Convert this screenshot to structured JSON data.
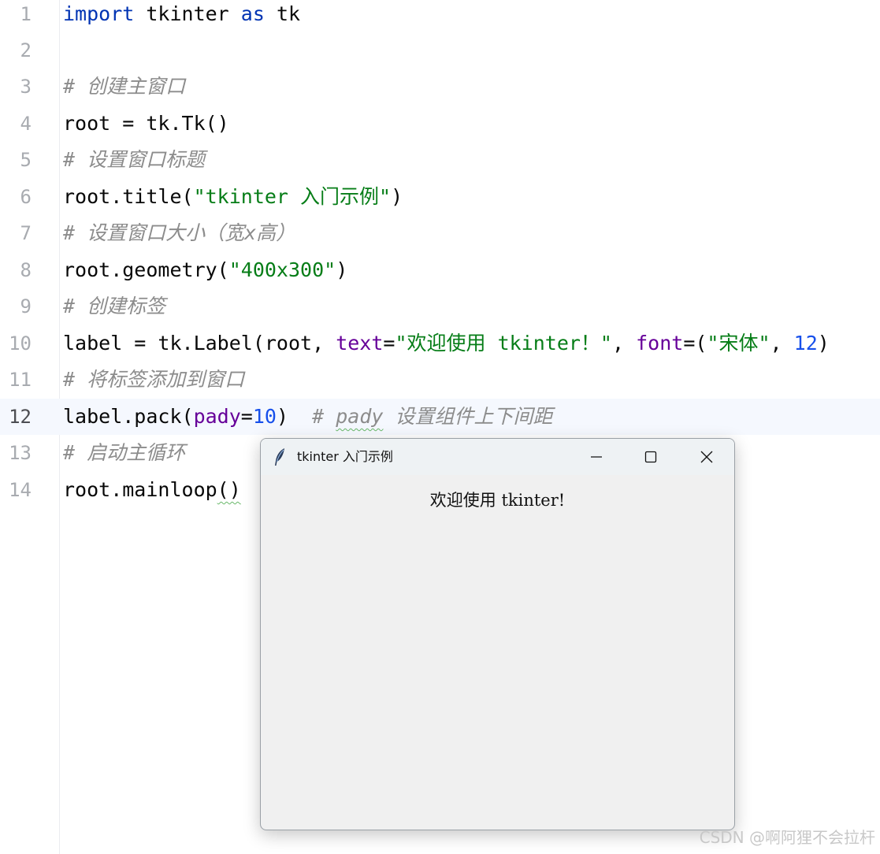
{
  "editor": {
    "current_line": 12,
    "line_numbers": [
      "1",
      "2",
      "3",
      "4",
      "5",
      "6",
      "7",
      "8",
      "9",
      "10",
      "11",
      "12",
      "13",
      "14"
    ],
    "code": {
      "l1": {
        "kw_import": "import",
        "mod1": " tkinter ",
        "kw_as": "as",
        "alias": " tk"
      },
      "l3": {
        "comment": "# 创建主窗口"
      },
      "l4": {
        "text": "root = tk.Tk()"
      },
      "l5": {
        "comment": "# 设置窗口标题"
      },
      "l6": {
        "pre": "root.title(",
        "str": "\"tkinter 入门示例\"",
        "post": ")"
      },
      "l7": {
        "comment": "# 设置窗口大小（宽x高）"
      },
      "l8": {
        "pre": "root.geometry(",
        "str": "\"400x300\"",
        "post": ")"
      },
      "l9": {
        "comment": "# 创建标签"
      },
      "l10": {
        "pre": "label = tk.Label(root, ",
        "p_text": "text",
        "eq1": "=",
        "str1": "\"欢迎使用 tkinter！\"",
        "sep": ", ",
        "p_font": "font",
        "eq2": "=(",
        "str2": "\"宋体\"",
        "comma": ", ",
        "num": "12",
        "post": ")"
      },
      "l11": {
        "comment": "# 将标签添加到窗口"
      },
      "l12": {
        "pre": "label.pack(",
        "p_pady": "pady",
        "eq": "=",
        "num": "10",
        "post": ")  ",
        "c_hash": "# ",
        "c_word": "pady",
        "c_rest": " 设置组件上下间距"
      },
      "l13": {
        "comment": "# 启动主循环"
      },
      "l14": {
        "pre": "root.mainloop",
        "parens": "()"
      }
    }
  },
  "tk_window": {
    "title": "tkinter 入门示例",
    "icon": "feather-icon",
    "label_text": "欢迎使用 tkinter!",
    "controls": [
      "minimize-icon",
      "maximize-icon",
      "close-icon"
    ]
  },
  "watermark": "CSDN @啊阿狸不会拉杆",
  "colors": {
    "keyword": "#0033b3",
    "string": "#067d17",
    "number": "#1750eb",
    "parameter": "#660099",
    "comment": "#8c8c8c",
    "current_line_bg": "#f5f8fe",
    "window_bg": "#f0f0f0"
  }
}
